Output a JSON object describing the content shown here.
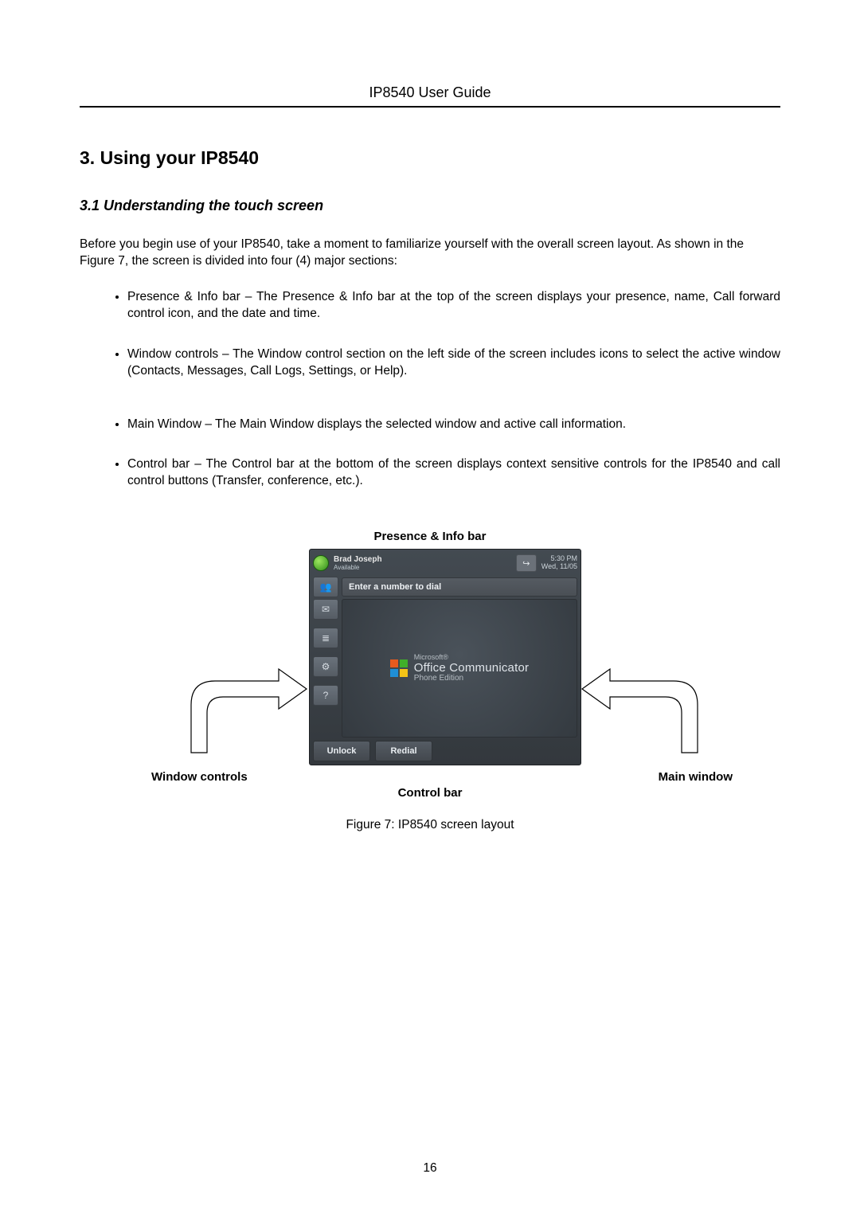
{
  "header": {
    "title": "IP8540 User Guide"
  },
  "section": {
    "title": "3.  Using your IP8540",
    "subsection_title": "3.1 Understanding the touch screen",
    "intro": "Before you begin use of your IP8540, take a moment to familiarize yourself with the overall screen layout. As shown in the Figure 7, the screen is divided into four (4) major sections:",
    "bullets": [
      "Presence & Info bar – The Presence & Info bar at the top of the screen displays your presence, name, Call forward control icon, and the date and time.",
      "Window controls – The Window control section on the left side of the screen includes icons to select the active window (Contacts, Messages, Call Logs, Settings, or Help).",
      "Main Window – The Main Window displays the selected window and active call information.",
      "Control bar – The Control bar at the bottom of the screen displays context sensitive controls for the IP8540 and call control buttons (Transfer, conference, etc.)."
    ]
  },
  "figure": {
    "label_top": "Presence & Info bar",
    "label_left": "Window controls",
    "label_right": "Main window",
    "label_bottom": "Control bar",
    "caption": "Figure 7: IP8540 screen layout"
  },
  "device": {
    "presence": {
      "name": "Brad Joseph",
      "status": "Available"
    },
    "forward_icon_glyph": "↪",
    "datetime": {
      "time": "5:30 PM",
      "date": "Wed, 11/05"
    },
    "dial_placeholder": "Enter a number to dial",
    "side_icons": [
      "contacts-icon",
      "messages-icon",
      "call-logs-icon",
      "settings-icon",
      "help-icon"
    ],
    "side_glyphs": [
      "👥",
      "✉",
      "≣",
      "⚙",
      "?"
    ],
    "logo": {
      "line1": "Microsoft®",
      "line2": "Office Communicator",
      "line3": "Phone Edition"
    },
    "controls": {
      "unlock": "Unlock",
      "redial": "Redial"
    }
  },
  "page_number": "16"
}
